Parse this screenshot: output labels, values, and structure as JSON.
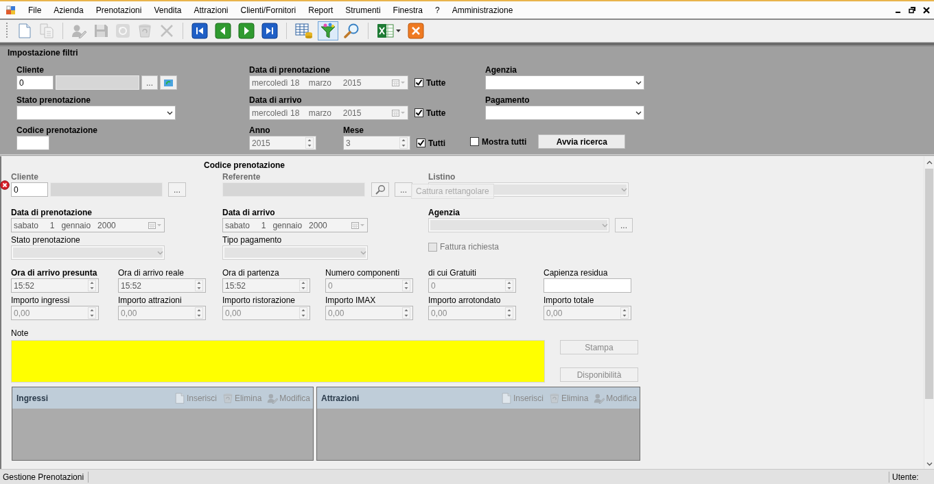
{
  "menu": {
    "items": [
      "File",
      "Azienda",
      "Prenotazioni",
      "Vendita",
      "Attrazioni",
      "Clienti/Fornitori",
      "Report",
      "Strumenti",
      "Finestra",
      "?",
      "Amministrazione"
    ]
  },
  "toolbar": [
    [
      {
        "kind": "new",
        "disabled": false,
        "selected": false
      },
      {
        "kind": "copy",
        "disabled": true,
        "selected": false
      }
    ],
    [
      {
        "kind": "edit",
        "disabled": true,
        "selected": false
      },
      {
        "kind": "save",
        "disabled": true,
        "selected": false
      },
      {
        "kind": "undo",
        "disabled": true,
        "selected": false
      },
      {
        "kind": "recycle",
        "disabled": true,
        "selected": false
      },
      {
        "kind": "delete",
        "disabled": true,
        "selected": false
      }
    ],
    [
      {
        "kind": "first",
        "disabled": false,
        "selected": false
      },
      {
        "kind": "prev",
        "disabled": false,
        "selected": false
      },
      {
        "kind": "next",
        "disabled": false,
        "selected": false
      },
      {
        "kind": "last",
        "disabled": false,
        "selected": false
      }
    ],
    [
      {
        "kind": "grid",
        "disabled": false,
        "selected": false
      },
      {
        "kind": "filter",
        "disabled": false,
        "selected": true
      },
      {
        "kind": "search",
        "disabled": false,
        "selected": false
      }
    ],
    [
      {
        "kind": "excel",
        "disabled": false,
        "selected": false
      },
      {
        "kind": "close",
        "disabled": false,
        "selected": false
      }
    ]
  ],
  "filters": {
    "title": "Impostazione filtri",
    "cliente": {
      "label": "Cliente",
      "code": "0",
      "browse": "..."
    },
    "stato": {
      "label": "Stato prenotazione"
    },
    "codice": {
      "label": "Codice prenotazione"
    },
    "data_prenotazione": {
      "label": "Data di prenotazione",
      "value": "mercoledì 18    marzo     2015",
      "disabled": true,
      "all_label": "Tutte",
      "all_checked": true
    },
    "data_arrivo": {
      "label": "Data di arrivo",
      "value": "mercoledì 18    marzo     2015",
      "disabled": true,
      "all_label": "Tutte",
      "all_checked": true
    },
    "anno": {
      "label": "Anno",
      "value": "2015",
      "disabled": true
    },
    "mese": {
      "label": "Mese",
      "value": "3",
      "disabled": true,
      "all_label": "Tutti",
      "all_checked": true
    },
    "agenzia": {
      "label": "Agenzia"
    },
    "pagamento": {
      "label": "Pagamento"
    },
    "mostra_tutti": {
      "label": "Mostra tutti",
      "checked": false
    },
    "search_button": "Avvia ricerca"
  },
  "booking": {
    "title": "Codice prenotazione",
    "cliente": {
      "label": "Cliente",
      "code": "0",
      "error": true,
      "browse": "..."
    },
    "referente": {
      "label": "Referente",
      "browse": "..."
    },
    "listino": {
      "label": "Listino"
    },
    "tooltip": "Cattura rettangolare",
    "data_prenotazione": {
      "label": "Data di prenotazione",
      "bold": true,
      "value": "sabato     1   gennaio   2000"
    },
    "data_arrivo": {
      "label": "Data di arrivo",
      "bold": true,
      "value": "sabato     1   gennaio   2000"
    },
    "agenzia": {
      "label": "Agenzia",
      "bold": true,
      "browse": "..."
    },
    "stato": {
      "label": "Stato prenotazione",
      "bold": false
    },
    "tipo_pagamento": {
      "label": "Tipo pagamento",
      "bold": false
    },
    "fattura": {
      "label": "Fattura richiesta",
      "checked": false,
      "disabled": true
    },
    "amounts": [
      {
        "label": "Ora di arrivo presunta",
        "bold": true,
        "kind": "spin",
        "value": "15:52",
        "disabled": false
      },
      {
        "label": "Ora di arrivo reale",
        "bold": false,
        "kind": "spin",
        "value": "15:52",
        "disabled": false
      },
      {
        "label": "Ora di partenza",
        "bold": false,
        "kind": "spin",
        "value": "15:52",
        "disabled": false
      },
      {
        "label": "Numero componenti",
        "bold": false,
        "kind": "spin",
        "value": "0",
        "disabled": true
      },
      {
        "label": "di cui Gratuiti",
        "bold": false,
        "kind": "spin",
        "value": "0",
        "disabled": true
      },
      {
        "label": "Capienza residua",
        "bold": false,
        "kind": "text"
      },
      {
        "label": "Importo ingressi",
        "bold": false,
        "kind": "spin",
        "value": "0,00",
        "disabled": true
      },
      {
        "label": "Importo attrazioni",
        "bold": false,
        "kind": "spin",
        "value": "0,00",
        "disabled": true
      },
      {
        "label": "Importo ristorazione",
        "bold": false,
        "kind": "spin",
        "value": "0,00",
        "disabled": true
      },
      {
        "label": "Importo IMAX",
        "bold": false,
        "kind": "spin",
        "value": "0,00",
        "disabled": true
      },
      {
        "label": "Importo arrotondato",
        "bold": false,
        "kind": "spin",
        "value": "0,00",
        "disabled": true
      },
      {
        "label": "Importo totale",
        "bold": false,
        "kind": "spin",
        "value": "0,00",
        "disabled": true
      }
    ],
    "note": {
      "label": "Note"
    },
    "buttons": [
      {
        "label": "Stampa",
        "disabled": true
      },
      {
        "label": "Disponibilità",
        "disabled": true
      }
    ],
    "panels": [
      {
        "title": "Ingressi",
        "actions": [
          {
            "kind": "new",
            "label": "Inserisci",
            "disabled": true
          },
          {
            "kind": "recycle",
            "label": "Elimina",
            "disabled": true
          },
          {
            "kind": "edit",
            "label": "Modifica",
            "disabled": true
          }
        ]
      },
      {
        "title": "Attrazioni",
        "actions": [
          {
            "kind": "new",
            "label": "Inserisci",
            "disabled": true
          },
          {
            "kind": "recycle",
            "label": "Elimina",
            "disabled": true
          },
          {
            "kind": "edit",
            "label": "Modifica",
            "disabled": true
          }
        ]
      }
    ]
  },
  "status_bar": {
    "left": "Gestione Prenotazioni",
    "user_label": "Utente:"
  }
}
